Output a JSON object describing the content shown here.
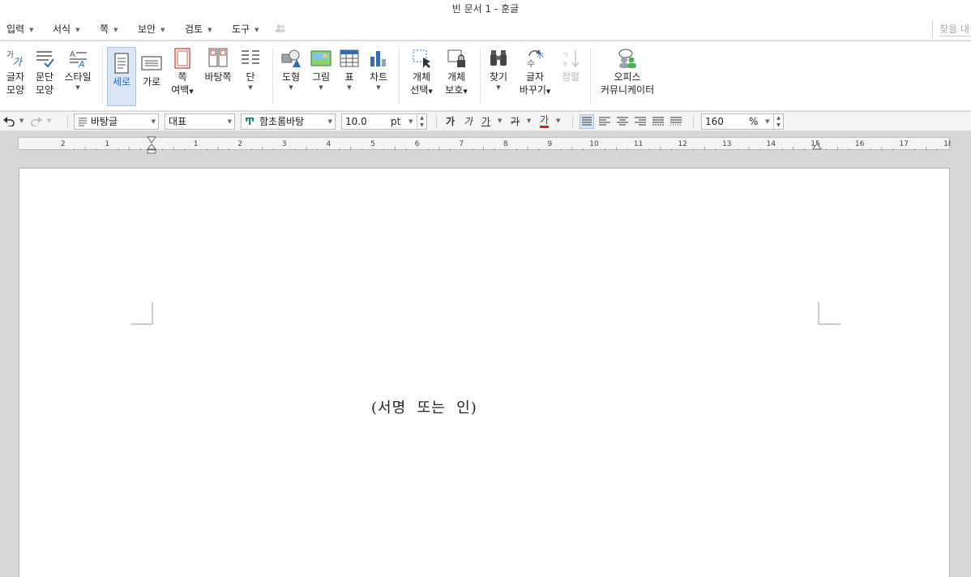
{
  "title_bar": {
    "title": "빈 문서 1 - 훈글"
  },
  "menu": {
    "items": [
      "입력",
      "서식",
      "쪽",
      "보안",
      "검토",
      "도구"
    ],
    "search_placeholder": "찾을 내용"
  },
  "ribbon": {
    "char_shape": {
      "line1": "글자",
      "line2": "모양"
    },
    "para_shape": {
      "line1": "문단",
      "line2": "모양"
    },
    "style": {
      "label": "스타일"
    },
    "portrait": {
      "label": "세로"
    },
    "landscape": {
      "label": "가로"
    },
    "margin": {
      "line1": "쪽",
      "line2": "여백"
    },
    "background": {
      "label": "바탕쪽"
    },
    "column": {
      "label": "단"
    },
    "shape": {
      "label": "도형"
    },
    "picture": {
      "label": "그림"
    },
    "table": {
      "label": "표"
    },
    "chart": {
      "label": "차트"
    },
    "select_object": {
      "line1": "개체",
      "line2": "선택"
    },
    "protect_object": {
      "line1": "개체",
      "line2": "보호"
    },
    "find": {
      "label": "찾기"
    },
    "replace": {
      "line1": "글자",
      "line2": "바꾸기"
    },
    "sort": {
      "label": "정렬"
    },
    "office_communicator": {
      "line1": "오피스",
      "line2": "커뮤니케이터"
    }
  },
  "format_bar": {
    "style_value": "바탕글",
    "lang_value": "대표",
    "font_value": "함초롬바탕",
    "size_value": "10.0",
    "size_unit": "pt",
    "bold_glyph": "가",
    "italic_glyph": "가",
    "underline_glyph": "가",
    "strike_glyph": "가",
    "color_glyph": "가",
    "zoom_value": "160",
    "zoom_unit": "%"
  },
  "ruler": {
    "labels": [
      "2",
      "1",
      "1",
      "2",
      "3",
      "4",
      "5",
      "6",
      "7",
      "8",
      "9",
      "10",
      "11",
      "12",
      "13",
      "14",
      "15",
      "16",
      "17",
      "18"
    ]
  },
  "document": {
    "text": "(서명  또는  인)"
  },
  "colors": {
    "accent": "#2f6db5",
    "font_color_bar": "#e02020",
    "active_button": "#dbe6f5"
  }
}
